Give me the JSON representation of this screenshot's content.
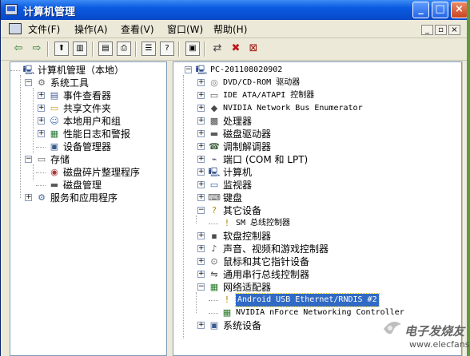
{
  "window": {
    "title": "计算机管理",
    "controls": {
      "minimize": "_",
      "maximize": "□",
      "close": "×"
    }
  },
  "menubar": {
    "items": [
      "文件(F)",
      "操作(A)",
      "查看(V)",
      "窗口(W)",
      "帮助(H)"
    ],
    "mdi_controls": [
      "_",
      "▫",
      "×"
    ]
  },
  "toolbar": {
    "icons": [
      "back-arrow-icon",
      "forward-arrow-icon",
      "up-folder-icon",
      "show-tree-icon",
      "export-list-icon",
      "print-icon",
      "properties-icon",
      "help-icon",
      "monitor-icon",
      "network-icon",
      "disable-icon",
      "uninstall-icon"
    ]
  },
  "left_tree": {
    "items": [
      {
        "label": "计算机管理（本地）",
        "level": 0,
        "expander": "",
        "icon": "computer-management-icon"
      },
      {
        "label": "系统工具",
        "level": 1,
        "expander": "−",
        "icon": "system-tools-icon"
      },
      {
        "label": "事件查看器",
        "level": 2,
        "expander": "+",
        "icon": "event-viewer-icon"
      },
      {
        "label": "共享文件夹",
        "level": 2,
        "expander": "+",
        "icon": "shared-folder-icon"
      },
      {
        "label": "本地用户和组",
        "level": 2,
        "expander": "+",
        "icon": "users-icon"
      },
      {
        "label": "性能日志和警报",
        "level": 2,
        "expander": "+",
        "icon": "performance-icon"
      },
      {
        "label": "设备管理器",
        "level": 2,
        "expander": "",
        "icon": "device-manager-icon"
      },
      {
        "label": "存储",
        "level": 1,
        "expander": "−",
        "icon": "storage-icon"
      },
      {
        "label": "磁盘碎片整理程序",
        "level": 2,
        "expander": "",
        "icon": "defrag-icon"
      },
      {
        "label": "磁盘管理",
        "level": 2,
        "expander": "",
        "icon": "disk-management-icon"
      },
      {
        "label": "服务和应用程序",
        "level": 1,
        "expander": "+",
        "icon": "services-icon"
      }
    ]
  },
  "right_tree": {
    "root": "PC-201108020902",
    "items": [
      {
        "label": "DVD/CD-ROM 驱动器",
        "level": 1,
        "expander": "+",
        "icon": "cdrom-icon"
      },
      {
        "label": "IDE ATA/ATAPI 控制器",
        "level": 1,
        "expander": "+",
        "icon": "ide-controller-icon"
      },
      {
        "label": "NVIDIA Network Bus Enumerator",
        "level": 1,
        "expander": "+",
        "icon": "network-bus-icon"
      },
      {
        "label": "处理器",
        "level": 1,
        "expander": "+",
        "icon": "processor-icon"
      },
      {
        "label": "磁盘驱动器",
        "level": 1,
        "expander": "+",
        "icon": "disk-drive-icon"
      },
      {
        "label": "调制解调器",
        "level": 1,
        "expander": "+",
        "icon": "modem-icon"
      },
      {
        "label": "端口 (COM 和 LPT)",
        "level": 1,
        "expander": "+",
        "icon": "port-icon"
      },
      {
        "label": "计算机",
        "level": 1,
        "expander": "+",
        "icon": "computer-icon"
      },
      {
        "label": "监视器",
        "level": 1,
        "expander": "+",
        "icon": "monitor-icon"
      },
      {
        "label": "键盘",
        "level": 1,
        "expander": "+",
        "icon": "keyboard-icon"
      },
      {
        "label": "其它设备",
        "level": 1,
        "expander": "−",
        "icon": "unknown-device-icon"
      },
      {
        "label": "SM 总线控制器",
        "level": 2,
        "expander": "",
        "icon": "warning-device-icon"
      },
      {
        "label": "软盘控制器",
        "level": 1,
        "expander": "+",
        "icon": "floppy-controller-icon"
      },
      {
        "label": "声音、视频和游戏控制器",
        "level": 1,
        "expander": "+",
        "icon": "sound-icon"
      },
      {
        "label": "鼠标和其它指针设备",
        "level": 1,
        "expander": "+",
        "icon": "mouse-icon"
      },
      {
        "label": "通用串行总线控制器",
        "level": 1,
        "expander": "+",
        "icon": "usb-icon"
      },
      {
        "label": "网络适配器",
        "level": 1,
        "expander": "−",
        "icon": "network-adapter-icon"
      },
      {
        "label": "Android USB Ethernet/RNDIS #2",
        "level": 2,
        "expander": "",
        "icon": "warning-network-adapter-icon",
        "selected": true
      },
      {
        "label": "NVIDIA nForce Networking Controller",
        "level": 2,
        "expander": "",
        "icon": "network-adapter-icon"
      },
      {
        "label": "系统设备",
        "level": 1,
        "expander": "+",
        "icon": "system-device-icon"
      }
    ]
  },
  "watermark": {
    "text": "电子发烧友",
    "url": "www.elecfans.com"
  },
  "colors": {
    "titlebar": "#0a5ae0",
    "selection": "#316ac5",
    "window_bg": "#ece9d8"
  }
}
